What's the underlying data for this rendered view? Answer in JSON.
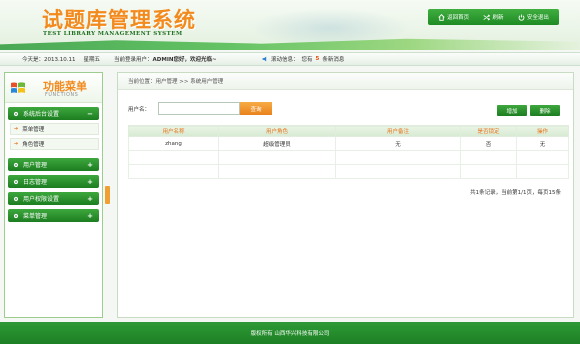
{
  "header": {
    "title": "试题库管理系统",
    "subtitle": "TEST LIBRARY MANAGEMENT SYSTEM",
    "buttons": [
      {
        "label": "返回首页",
        "icon": "home-icon"
      },
      {
        "label": "刷新",
        "icon": "refresh-icon"
      },
      {
        "label": "安全退出",
        "icon": "power-icon"
      }
    ]
  },
  "infobar": {
    "date": "今天是：2013.10.11",
    "week": "星期五",
    "user_prefix": "当前登录用户：",
    "user_name": "ADMIN您好，欢迎光临~",
    "notice_prefix": "滚动信息：",
    "notice_mid": "您有",
    "notice_count": "5",
    "notice_suffix": "条新消息"
  },
  "sidebar": {
    "title": "功能菜单",
    "subtitle": "FUNCTIONS",
    "groups": [
      {
        "label": "系统后台设置",
        "sign": "−"
      },
      {
        "label": "用户管理",
        "sign": "+"
      },
      {
        "label": "日志管理",
        "sign": "+"
      },
      {
        "label": "用户权限设置",
        "sign": "+"
      },
      {
        "label": "菜单管理",
        "sign": "+"
      }
    ],
    "subitems": [
      {
        "label": "菜单管理"
      },
      {
        "label": "角色管理"
      }
    ]
  },
  "main": {
    "breadcrumb": "当前位置：用户管理 >> 系统用户管理",
    "search": {
      "label": "用户名：",
      "value": "",
      "placeholder": "",
      "button": "查询"
    },
    "actions": {
      "add": "增加",
      "delete": "删除"
    },
    "table": {
      "headers": [
        "用户名称",
        "用户角色",
        "用户备注",
        "是否锁定",
        "操作"
      ],
      "rows": [
        [
          "zhang",
          "超级管理员",
          "无",
          "否",
          "无"
        ]
      ]
    },
    "pager": "共1条记录，当前第1/1页，每页15条"
  },
  "footer": {
    "text": "版权所有 山西华兴科技有限公司"
  },
  "colors": {
    "brand_green": "#1f8a24",
    "accent_orange": "#f28a1d"
  }
}
